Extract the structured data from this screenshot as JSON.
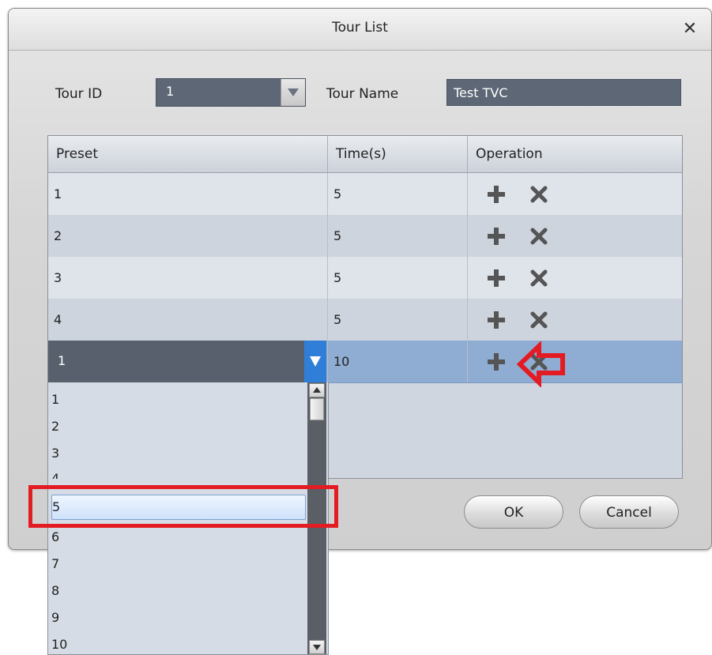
{
  "dialog": {
    "title": "Tour List",
    "close_icon": "close-icon"
  },
  "form": {
    "tour_id_label": "Tour ID",
    "tour_id_value": "1",
    "tour_name_label": "Tour Name",
    "tour_name_value": "Test TVC"
  },
  "table": {
    "headers": [
      "Preset",
      "Time(s)",
      "Operation"
    ],
    "rows": [
      {
        "preset": "1",
        "time": "5"
      },
      {
        "preset": "2",
        "time": "5"
      },
      {
        "preset": "3",
        "time": "5"
      },
      {
        "preset": "4",
        "time": "5"
      },
      {
        "preset": "1",
        "time": "10",
        "selected": true
      }
    ],
    "operation_icons": [
      "plus-icon",
      "close-icon"
    ]
  },
  "dropdown": {
    "options": [
      "1",
      "2",
      "3",
      "4",
      "5",
      "6",
      "7",
      "8",
      "9",
      "10"
    ],
    "highlighted": "5"
  },
  "buttons": {
    "ok": "OK",
    "cancel": "Cancel"
  },
  "colors": {
    "selected_row": "#8facd2",
    "annotation": "#e31b23",
    "input_bg": "#5e6775"
  }
}
